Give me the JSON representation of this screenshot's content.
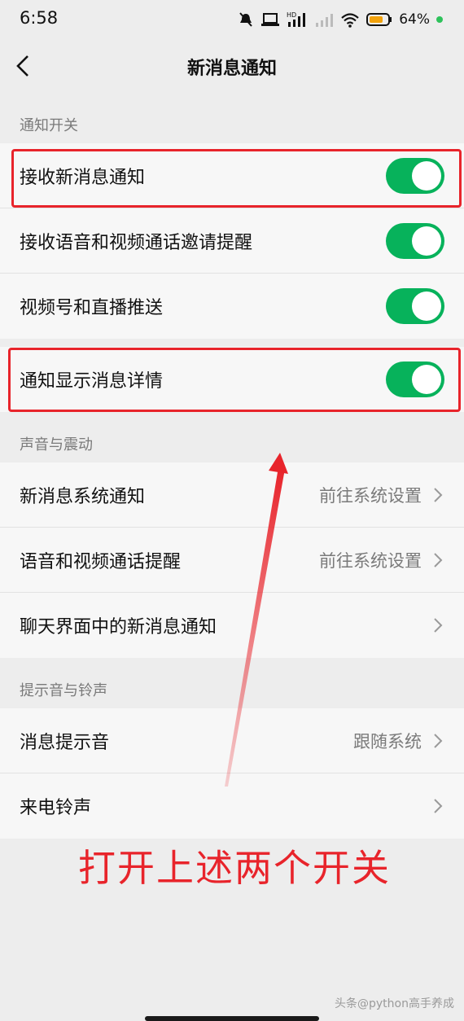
{
  "status_bar": {
    "time": "6:58",
    "battery_percent": "64%",
    "icons": [
      "mute-icon",
      "laptop-icon",
      "hd-signal-icon",
      "signal-icon",
      "wifi-icon",
      "battery-icon"
    ]
  },
  "header": {
    "back_icon": "chevron-left-icon",
    "title": "新消息通知"
  },
  "sections": {
    "notify_switch": {
      "title": "通知开关",
      "rows": [
        {
          "label": "接收新消息通知",
          "toggle_on": true
        },
        {
          "label": "接收语音和视频通话邀请提醒",
          "toggle_on": true
        },
        {
          "label": "视频号和直播推送",
          "toggle_on": true
        }
      ]
    },
    "detail_row": {
      "label": "通知显示消息详情",
      "toggle_on": true
    },
    "sound_vibration": {
      "title": "声音与震动",
      "rows": [
        {
          "label": "新消息系统通知",
          "value": "前往系统设置"
        },
        {
          "label": "语音和视频通话提醒",
          "value": "前往系统设置"
        },
        {
          "label": "聊天界面中的新消息通知",
          "value": ""
        }
      ]
    },
    "ringtone": {
      "title": "提示音与铃声",
      "rows": [
        {
          "label": "消息提示音",
          "value": "跟随系统"
        },
        {
          "label": "来电铃声",
          "value": ""
        }
      ]
    }
  },
  "annotation": {
    "text": "打开上述两个开关",
    "color": "#e8242b"
  },
  "watermark": "头条@python高手养成",
  "colors": {
    "toggle_on": "#07b25b",
    "background": "#ededed",
    "row_background": "#f7f7f7",
    "secondary_text": "#7a7a7a"
  }
}
